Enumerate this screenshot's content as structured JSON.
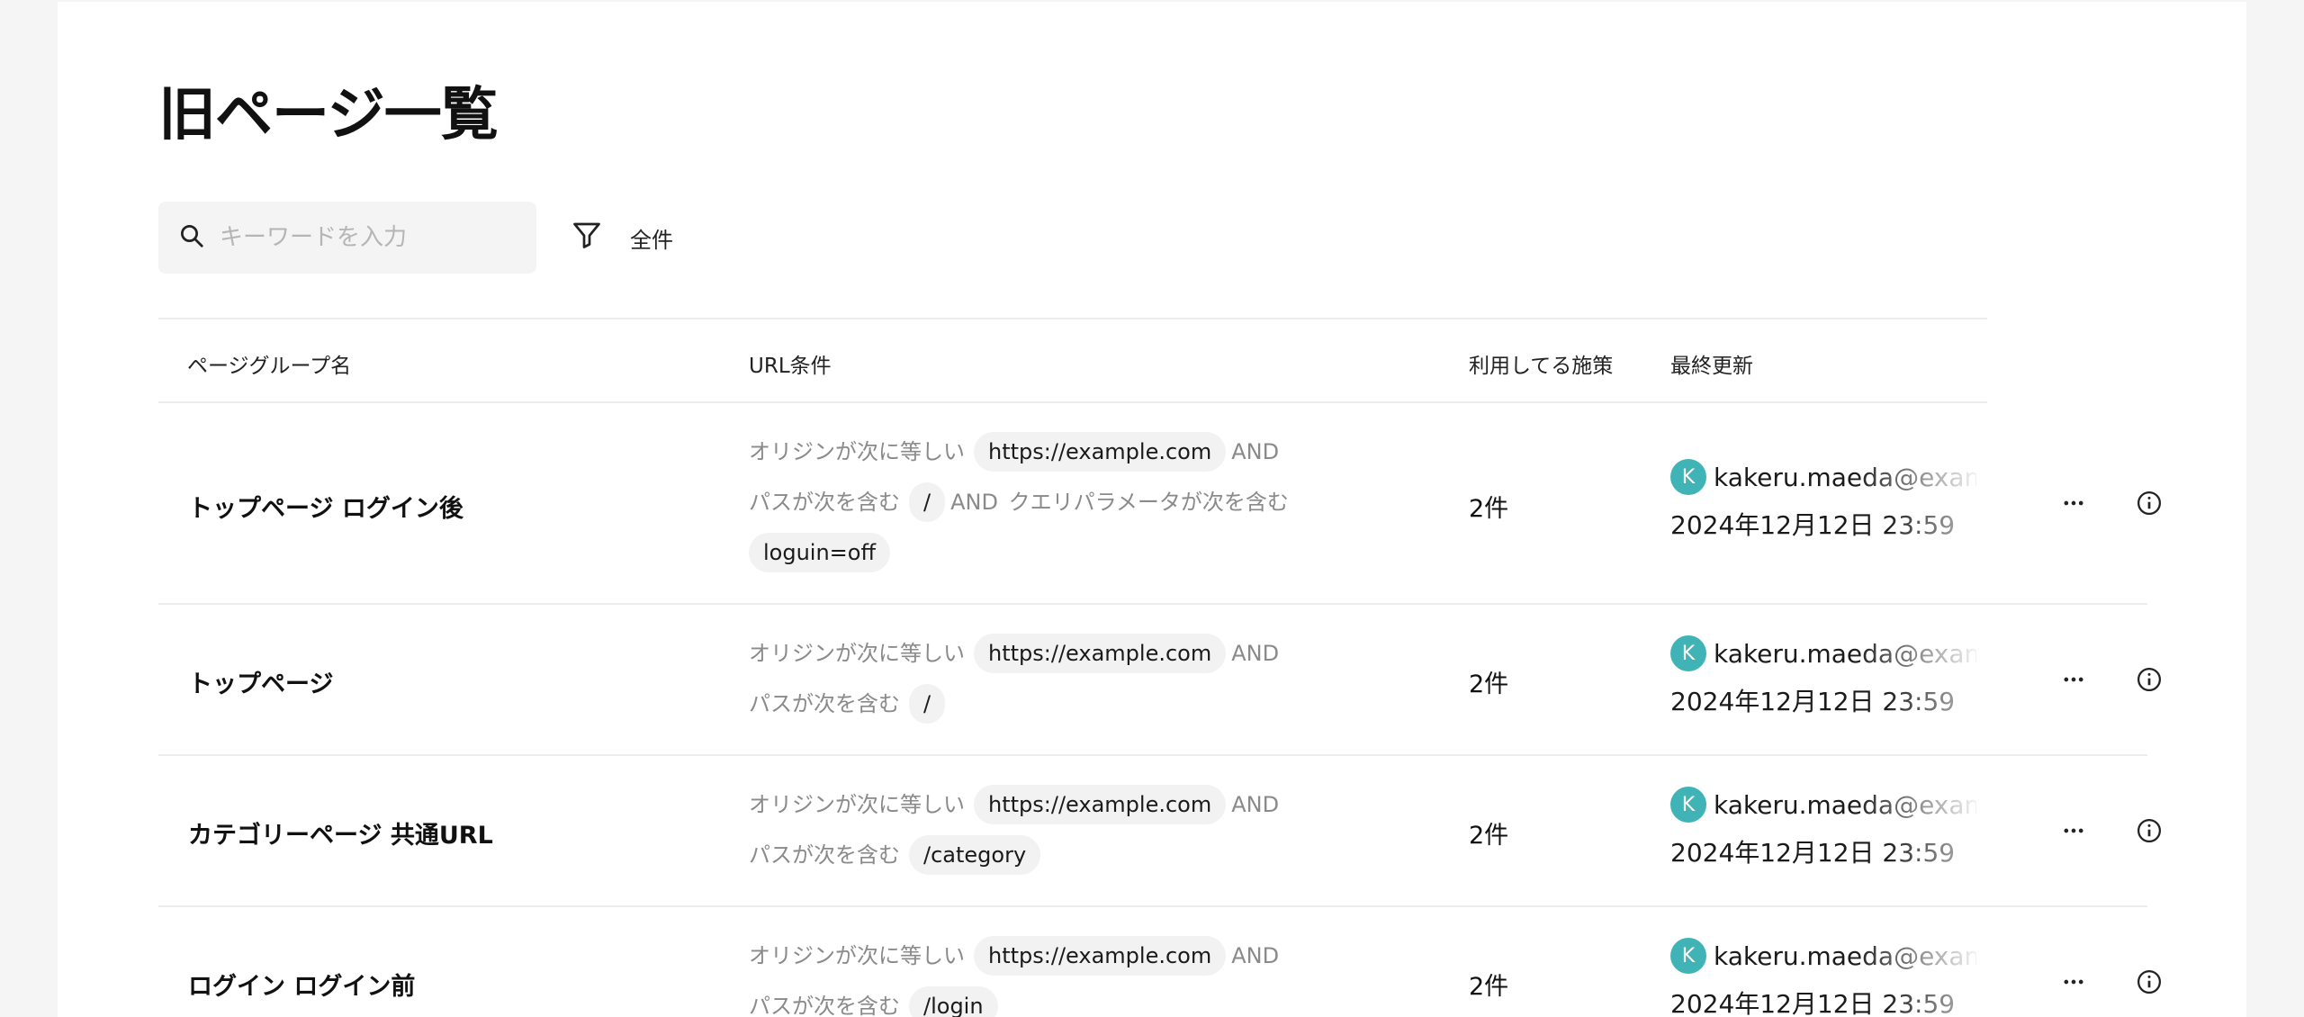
{
  "page": {
    "title": "旧ページ一覧"
  },
  "toolbar": {
    "search_placeholder": "キーワードを入力",
    "filter_label": "全件"
  },
  "table": {
    "columns": [
      "ページグループ名",
      "URL条件",
      "利用してる施策",
      "最終更新"
    ],
    "rows": [
      {
        "name": "トップページ ログイン後",
        "origin_label": "オリジンが次に等しい",
        "origin_value": "https://example.com",
        "and1": "AND",
        "path_label": "パスが次を含む",
        "path_value": "/",
        "and2": "AND",
        "query_label": "クエリパラメータが次を含む",
        "query_value": "loguin=off",
        "count": "2件",
        "avatar_initial": "K",
        "user": "kakeru.maeda@example.com",
        "date": "2024年12月12日 23:59"
      },
      {
        "name": "トップページ",
        "origin_label": "オリジンが次に等しい",
        "origin_value": "https://example.com",
        "and1": "AND",
        "path_label": "パスが次を含む",
        "path_value": "/",
        "count": "2件",
        "avatar_initial": "K",
        "user": "kakeru.maeda@example.com",
        "date": "2024年12月12日 23:59"
      },
      {
        "name": "カテゴリーページ 共通URL",
        "origin_label": "オリジンが次に等しい",
        "origin_value": "https://example.com",
        "and1": "AND",
        "path_label": "パスが次を含む",
        "path_value": "/category",
        "count": "2件",
        "avatar_initial": "K",
        "user": "kakeru.maeda@example.com",
        "date": "2024年12月12日 23:59"
      },
      {
        "name": "ログイン ログイン前",
        "origin_label": "オリジンが次に等しい",
        "origin_value": "https://example.com",
        "and1": "AND",
        "path_label": "パスが次を含む",
        "path_value": "/login",
        "count": "2件",
        "avatar_initial": "K",
        "user": "kakeru.maeda@example.com",
        "date": "2024年12月12日 23:59"
      }
    ]
  },
  "icons": {
    "search": "search-icon",
    "filter": "filter-icon",
    "more": "more-horizontal-icon",
    "info": "info-icon"
  },
  "colors": {
    "avatar": "#3fb3b6",
    "background": "#f4f5f4"
  }
}
